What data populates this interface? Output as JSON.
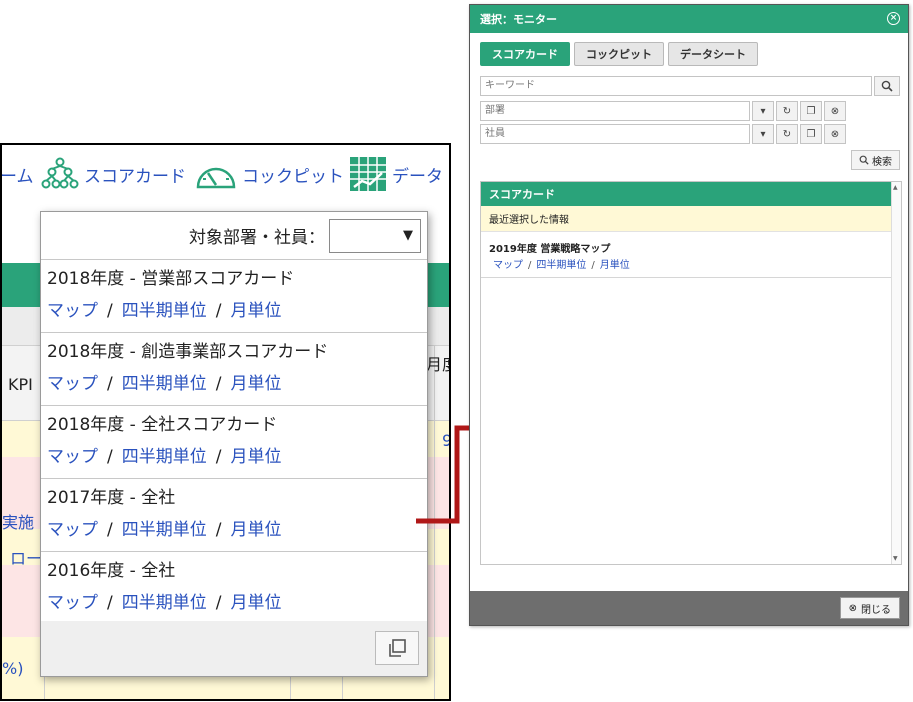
{
  "left": {
    "nav": {
      "home_fragment": "ーム",
      "scorecard": "スコアカード",
      "cockpit": "コックピット",
      "datasheet_fragment": "データ"
    },
    "dropdown": {
      "header_label": "対象部署・社員：",
      "select_value": "",
      "items": [
        {
          "title": "2018年度 - 営業部スコアカード",
          "links": [
            "マップ",
            "四半期単位",
            "月単位"
          ]
        },
        {
          "title": "2018年度 - 創造事業部スコアカード",
          "links": [
            "マップ",
            "四半期単位",
            "月単位"
          ]
        },
        {
          "title": "2018年度 - 全社スコアカード",
          "links": [
            "マップ",
            "四半期単位",
            "月単位"
          ]
        },
        {
          "title": "2017年度 - 全社",
          "links": [
            "マップ",
            "四半期単位",
            "月単位"
          ]
        },
        {
          "title": "2016年度 - 全社",
          "links": [
            "マップ",
            "四半期単位",
            "月単位"
          ]
        }
      ],
      "separator": "/"
    },
    "background": {
      "kpi": "KPI",
      "month_fragment": "月度",
      "implement_fragment": "実施",
      "ro_fragment": "ロー",
      "percent_fragment": "%)",
      "number_fragment": "9"
    }
  },
  "dialog": {
    "title": "選択：モニター",
    "tabs": [
      "スコアカード",
      "コックピット",
      "データシート"
    ],
    "keyword_placeholder": "キーワード",
    "department_placeholder": "部署",
    "employee_placeholder": "社員",
    "search_label": "検索",
    "panel_header": "スコアカード",
    "recent_label": "最近選択した情報",
    "entry": {
      "title": "2019年度 営業戦略マップ",
      "links": [
        "マップ",
        "四半期単位",
        "月単位"
      ]
    },
    "separator": "/",
    "close_label": "閉じる"
  },
  "colors": {
    "accent": "#2aa37a",
    "link": "#2a52be",
    "arrow": "#b01818"
  }
}
